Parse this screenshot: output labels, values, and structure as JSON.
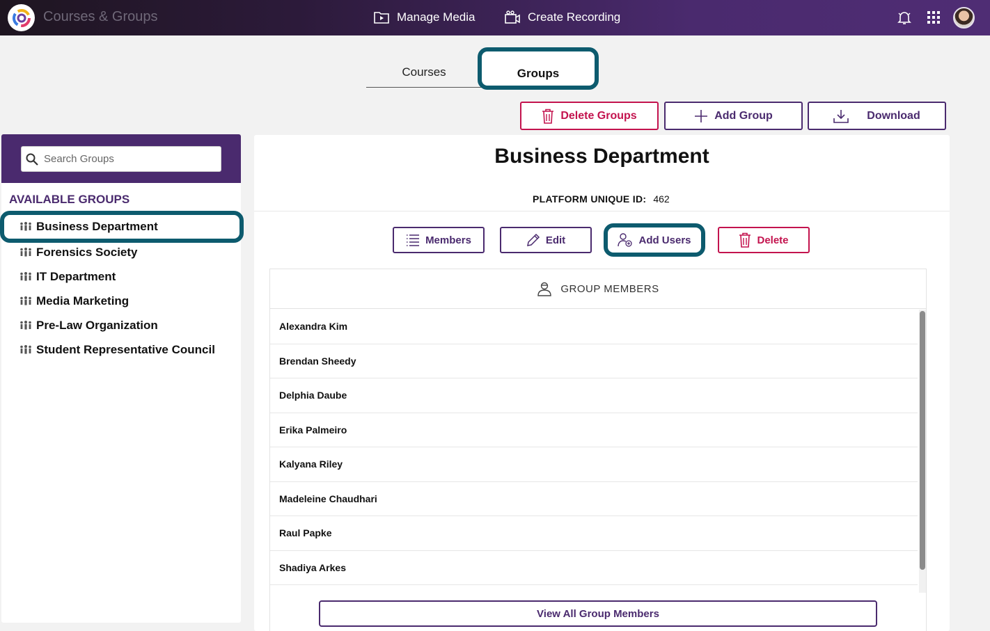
{
  "topbar": {
    "app_title": "Courses & Groups",
    "nav": {
      "manage_media": "Manage Media",
      "create_recording": "Create Recording"
    }
  },
  "tabs": {
    "courses": "Courses",
    "groups": "Groups",
    "active": "Groups"
  },
  "actions": {
    "delete_groups": "Delete Groups",
    "add_group": "Add Group",
    "download": "Download"
  },
  "sidebar": {
    "search_placeholder": "Search Groups",
    "title": "AVAILABLE GROUPS",
    "groups": [
      {
        "label": "Business Department",
        "selected": true
      },
      {
        "label": "Forensics Society",
        "selected": false
      },
      {
        "label": "IT Department",
        "selected": false
      },
      {
        "label": "Media Marketing",
        "selected": false
      },
      {
        "label": "Pre-Law Organization",
        "selected": false
      },
      {
        "label": "Student Representative Council",
        "selected": false
      }
    ]
  },
  "main": {
    "title": "Business Department",
    "platform_id_label": "PLATFORM UNIQUE ID:",
    "platform_id_value": "462",
    "buttons": {
      "members": "Members",
      "edit": "Edit",
      "add_users": "Add Users",
      "delete": "Delete"
    },
    "members_header": "GROUP MEMBERS",
    "members": [
      "Alexandra Kim",
      "Brendan Sheedy",
      "Delphia Daube",
      "Erika Palmeiro",
      "Kalyana Riley",
      "Madeleine Chaudhari",
      "Raul Papke",
      "Shadiya Arkes"
    ],
    "view_all": "View All Group Members"
  },
  "colors": {
    "brand_purple": "#4a2a6e",
    "danger_red": "#c3134e",
    "highlight_teal": "#0d5b6e"
  }
}
